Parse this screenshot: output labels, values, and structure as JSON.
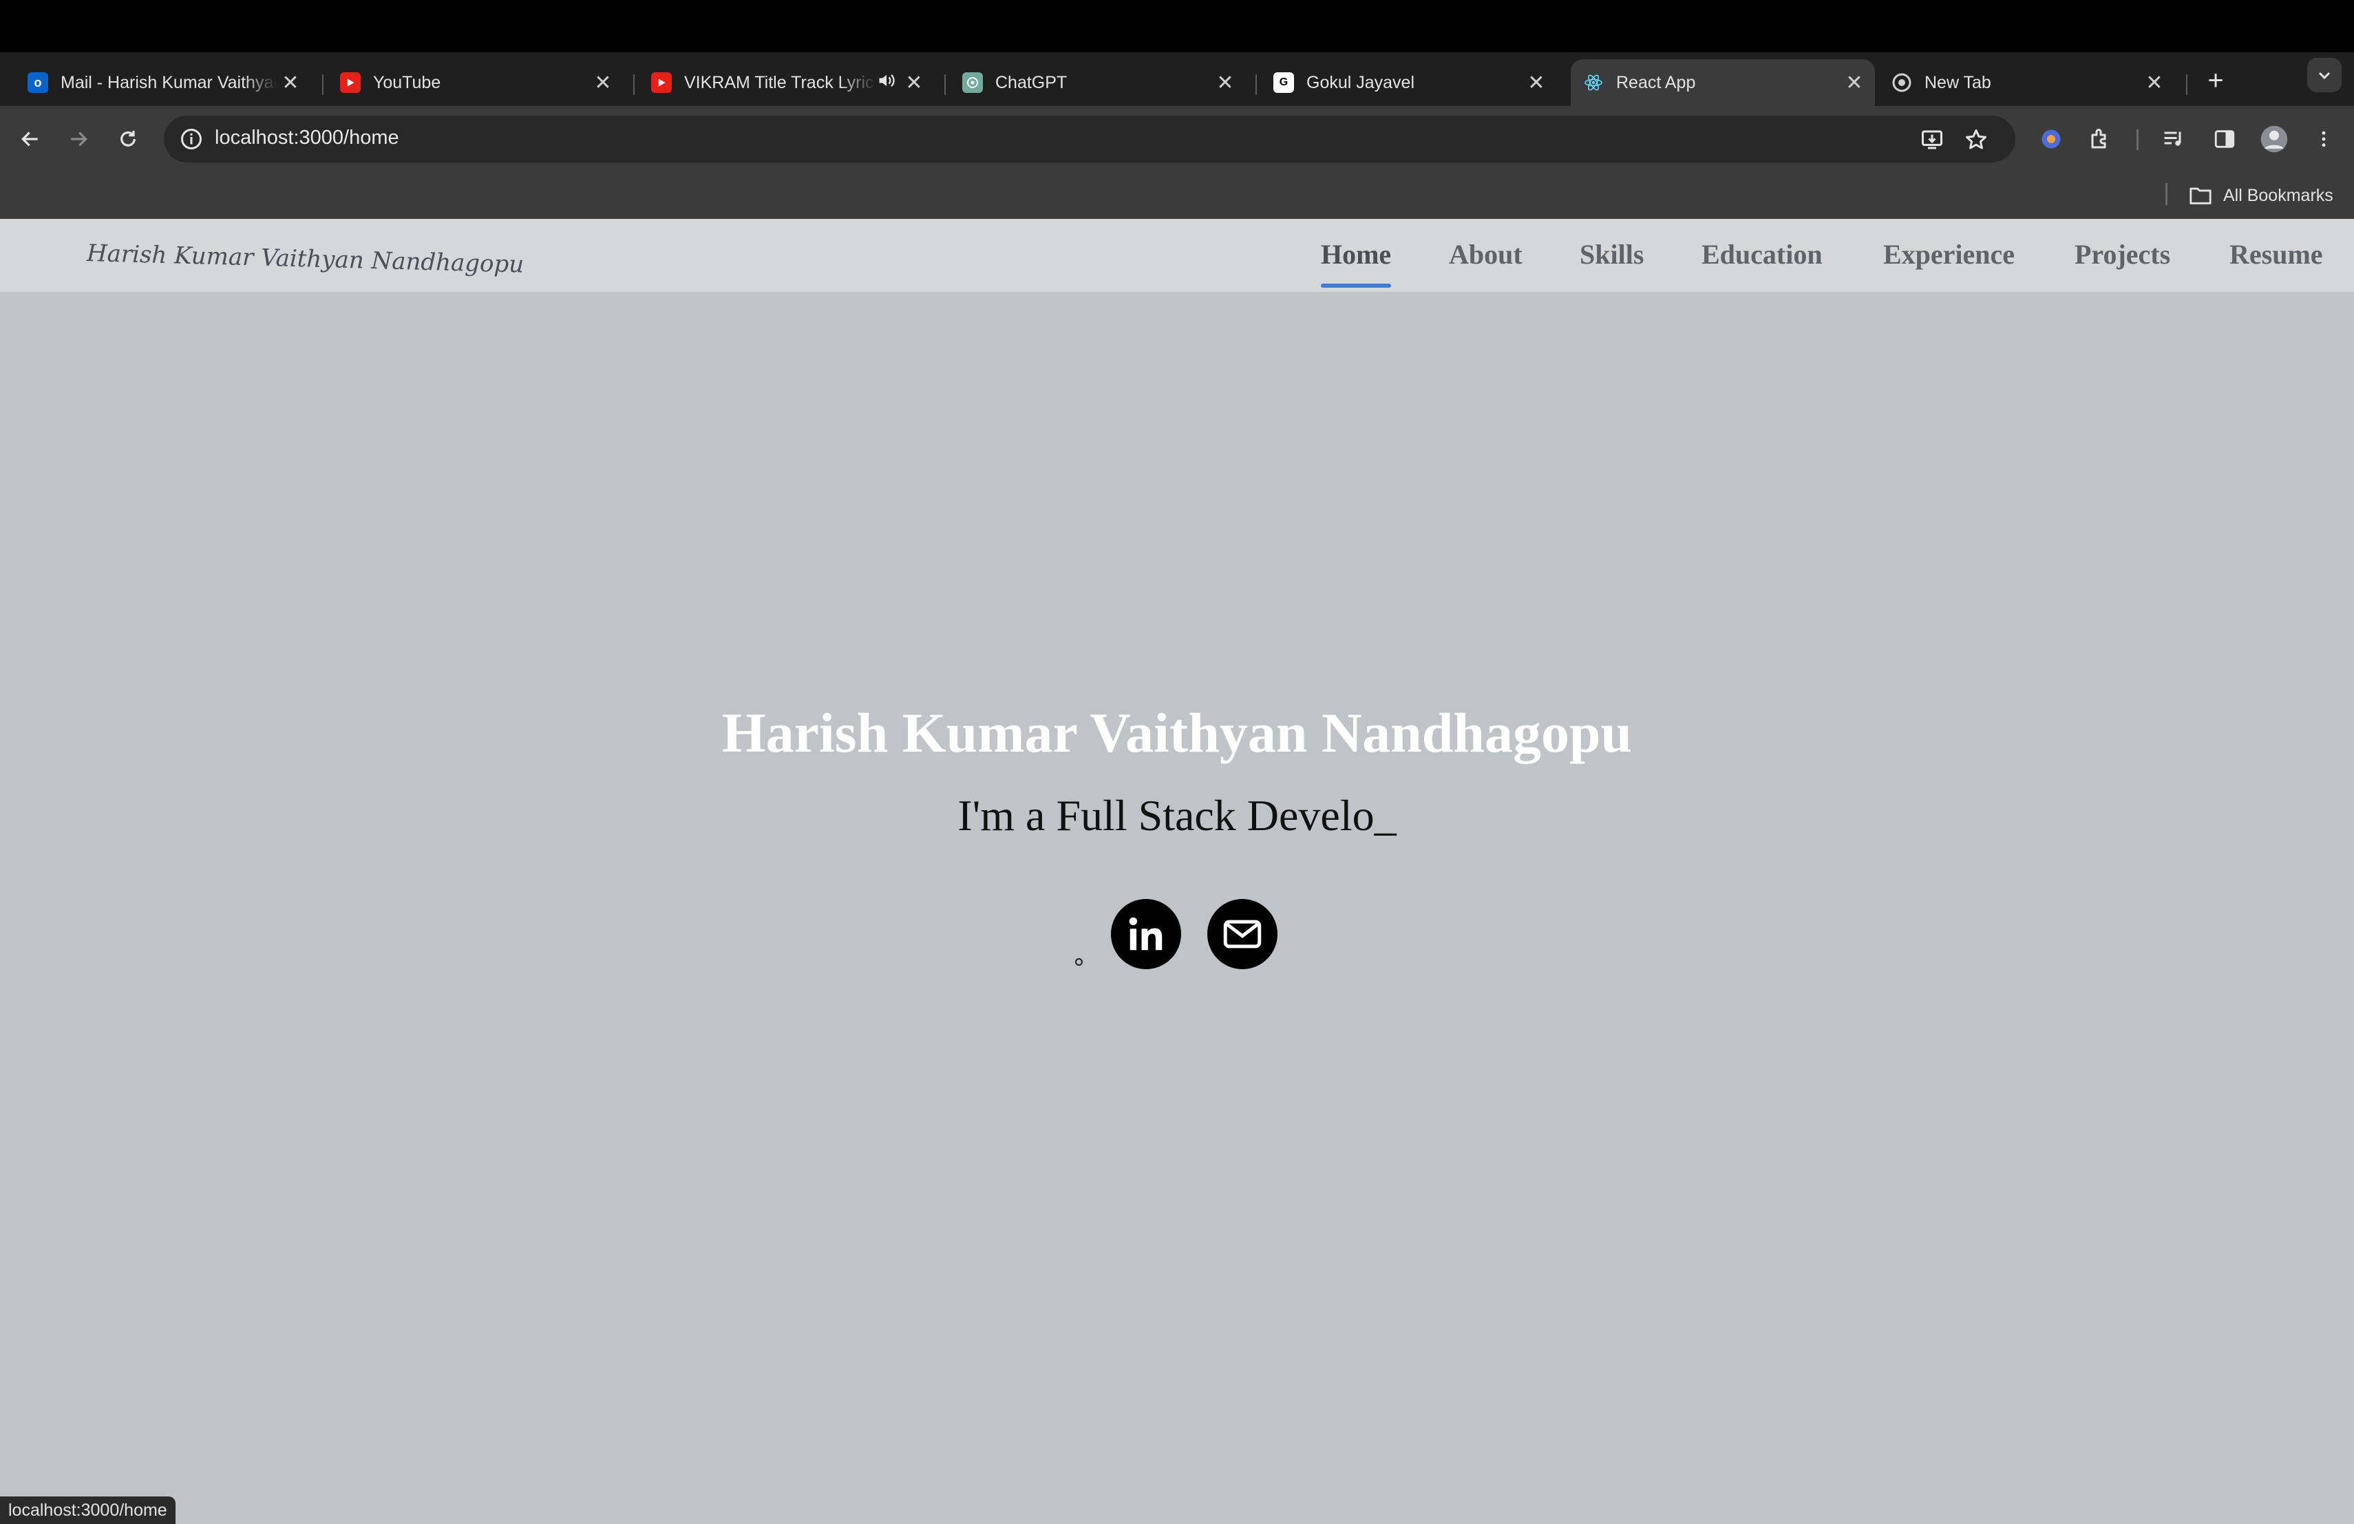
{
  "tabs": [
    {
      "title": "Mail - Harish Kumar Vaithyanathan Nandhagopu",
      "icon": "outlook-icon"
    },
    {
      "title": "YouTube",
      "icon": "youtube-icon"
    },
    {
      "title": "VIKRAM Title Track Lyric",
      "icon": "youtube-icon",
      "audio": true
    },
    {
      "title": "ChatGPT",
      "icon": "chatgpt-icon"
    },
    {
      "title": "Gokul Jayavel",
      "icon": "site-icon"
    },
    {
      "title": "React App",
      "icon": "react-icon",
      "active": true
    },
    {
      "title": "New Tab",
      "icon": "chrome-icon"
    }
  ],
  "tab_close_glyph": "✕",
  "new_tab_glyph": "+",
  "toolbar": {
    "url": "localhost:3000/home"
  },
  "bookmarks": {
    "all_label": "All Bookmarks"
  },
  "site": {
    "brand": "Harish Kumar Vaithyan Nandhagopu",
    "nav": [
      "Home",
      "About",
      "Skills",
      "Education",
      "Experience",
      "Projects",
      "Resume"
    ],
    "active_nav": "Home",
    "hero_name": "Harish Kumar Vaithyan Nandhagopu",
    "hero_subtitle": "I'm a Full Stack Develo_",
    "social": [
      "linkedin-icon",
      "email-icon"
    ]
  },
  "status_bar": "localhost:3000/home",
  "colors": {
    "page_bg": "#c0c3c7",
    "navbar_bg": "#d5d7db",
    "nav_underline": "#3d7edb",
    "hero_name": "#ffffff"
  }
}
